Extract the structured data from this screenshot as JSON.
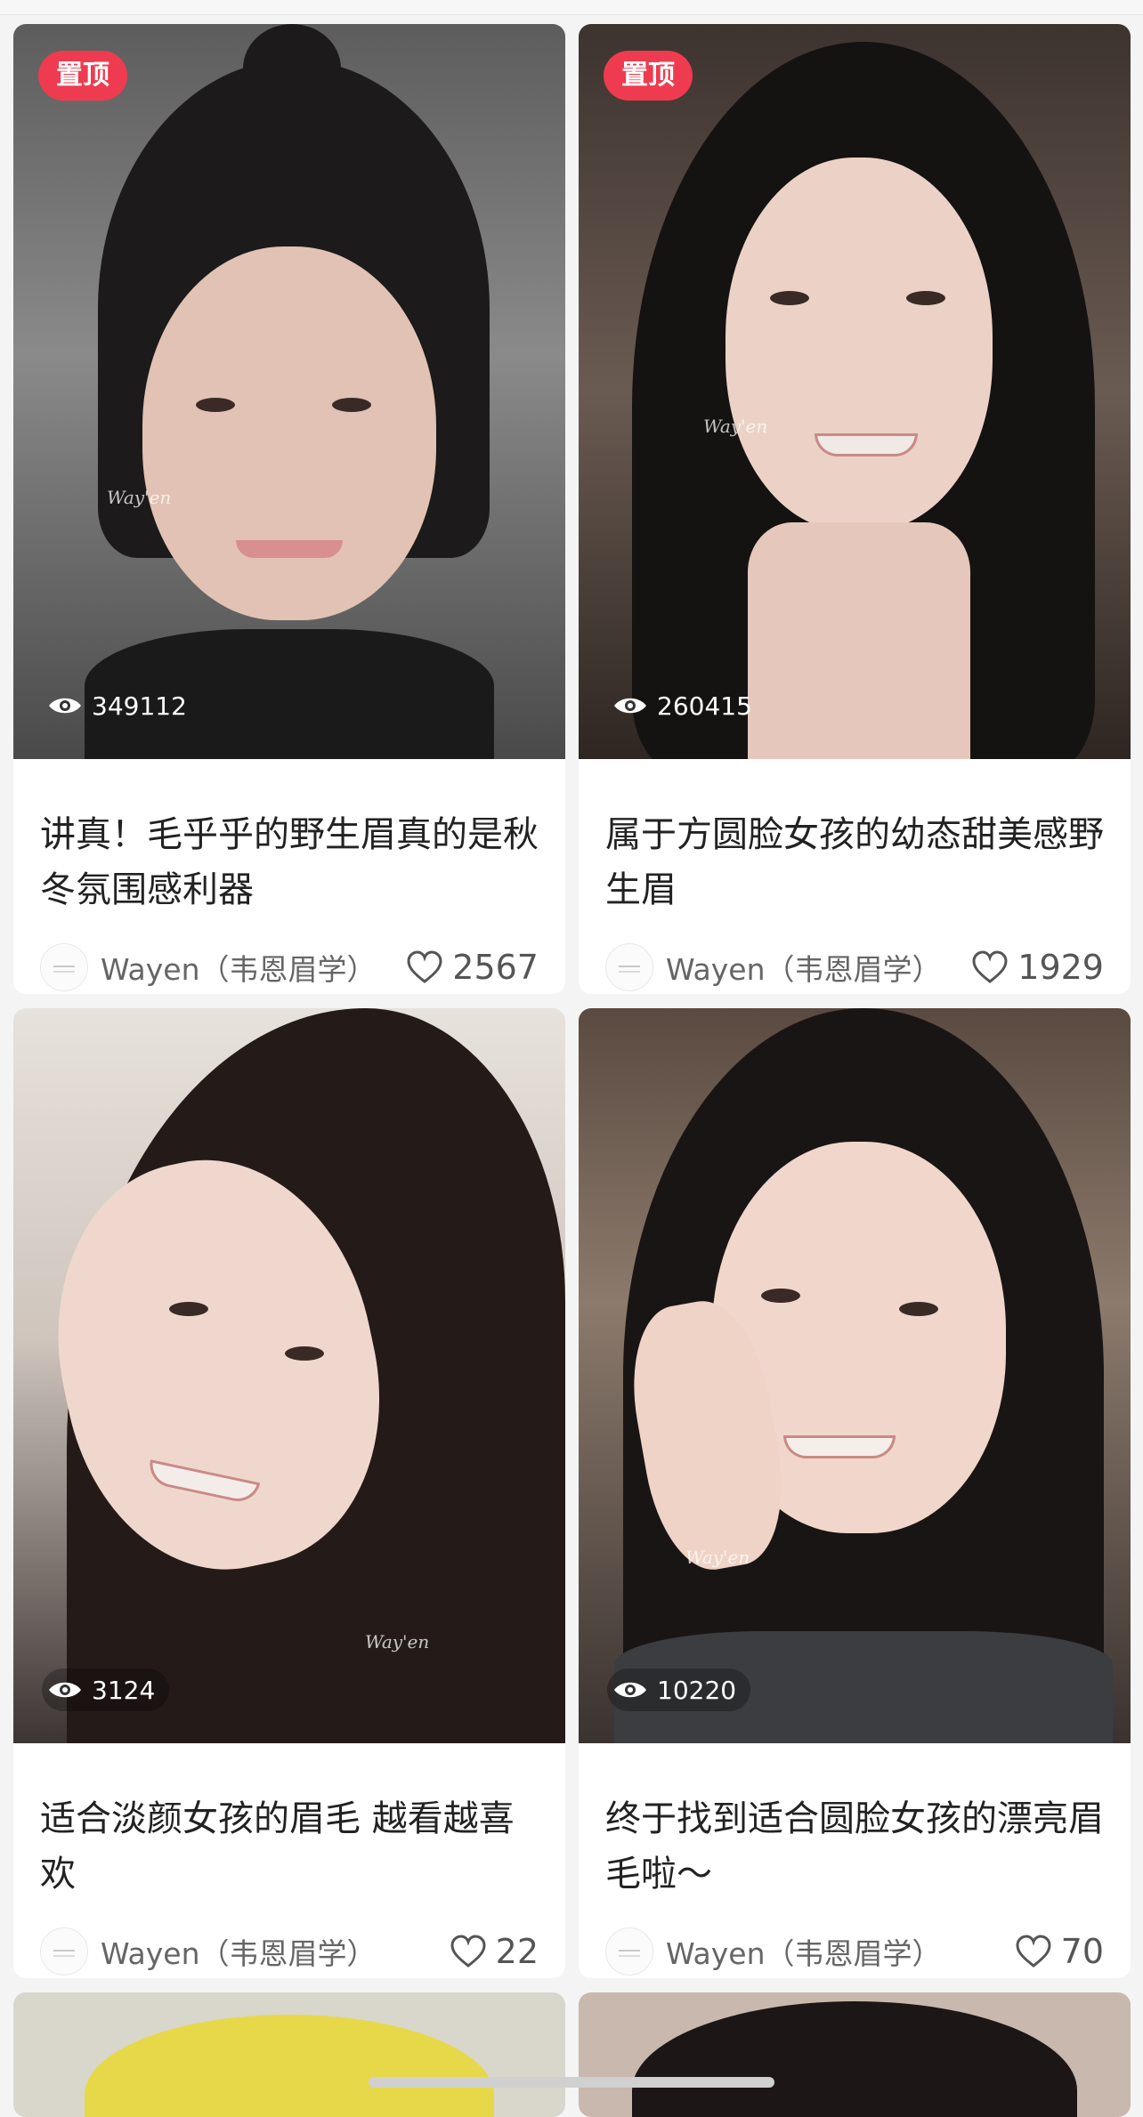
{
  "feed": {
    "posts": [
      {
        "pin_label": "置顶",
        "views": "349112",
        "title": "讲真！毛乎乎的野生眉真的是秋冬氛围感利器",
        "author": "Wayen（韦恩眉学）",
        "likes": "2567",
        "watermark": "Way'en"
      },
      {
        "pin_label": "置顶",
        "views": "260415",
        "title": "属于方圆脸女孩的幼态甜美感野生眉",
        "author": "Wayen（韦恩眉学）",
        "likes": "1929",
        "watermark": "Way'en"
      },
      {
        "views": "3124",
        "title": "适合淡颜女孩的眉毛 越看越喜欢",
        "author": "Wayen（韦恩眉学）",
        "likes": "22",
        "watermark": "Way'en"
      },
      {
        "views": "10220",
        "title": "终于找到适合圆脸女孩的漂亮眉毛啦～",
        "author": "Wayen（韦恩眉学）",
        "likes": "70",
        "watermark": "Way'en"
      }
    ]
  },
  "colors": {
    "pin": "#ef3b4f",
    "background": "#f4f4f4",
    "card": "#ffffff"
  },
  "icons": {
    "views": "eye-icon",
    "likes": "heart-outline-icon"
  }
}
